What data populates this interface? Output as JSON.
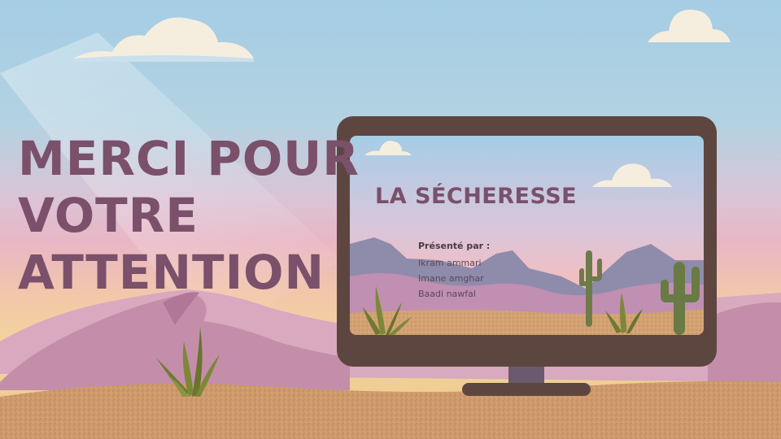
{
  "slide": {
    "headline_lines": [
      "MERCI POUR",
      "VOTRE",
      "ATTENTION"
    ],
    "screen_title": "LA SÉCHERESSE",
    "presenters_label": "Présenté par :",
    "presenters": [
      "Ikram ammari",
      "Imane amghar",
      "Baadi nawfal"
    ]
  },
  "colors": {
    "sky": "#a5cde4",
    "headline": "#7a506a",
    "monitor_frame": "#5e4640",
    "sand": "#cf9b6c",
    "mountains": "#c690ac"
  },
  "icons": [
    "cloud-icon",
    "cactus-icon",
    "agave-plant-icon",
    "monitor-icon"
  ]
}
